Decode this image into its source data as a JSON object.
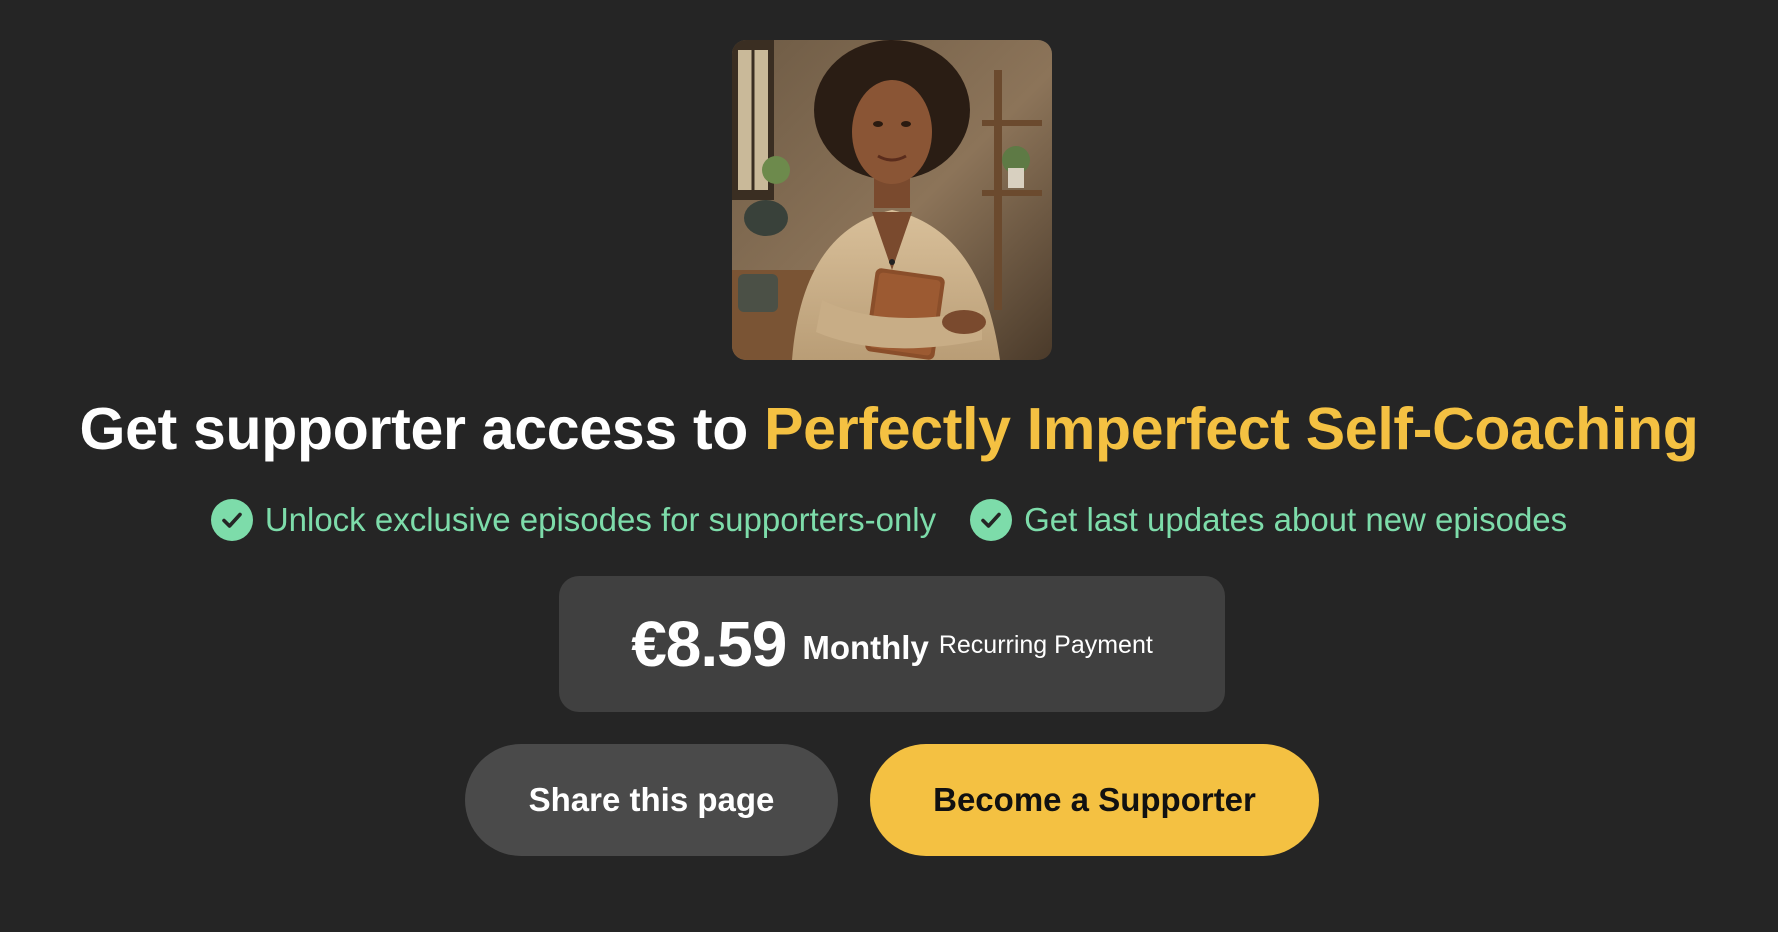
{
  "cover": {
    "alt": "Podcast cover: woman in a beige cardigan holding a brown notebook"
  },
  "headline": {
    "prefix": "Get supporter access to ",
    "podcast_name": "Perfectly Imperfect Self-Coaching"
  },
  "features": [
    {
      "icon": "check-circle-icon",
      "text": "Unlock exclusive episodes for supporters-only"
    },
    {
      "icon": "check-circle-icon",
      "text": "Get last updates about new episodes"
    }
  ],
  "pricing": {
    "amount": "€8.59",
    "period": "Monthly",
    "note": "Recurring Payment"
  },
  "actions": {
    "share_label": "Share this page",
    "support_label": "Become a Supporter"
  },
  "colors": {
    "background": "#252525",
    "accent": "#f4c142",
    "feature_green": "#7ddcaa",
    "panel": "#404040",
    "secondary_button": "#4a4a4a"
  }
}
